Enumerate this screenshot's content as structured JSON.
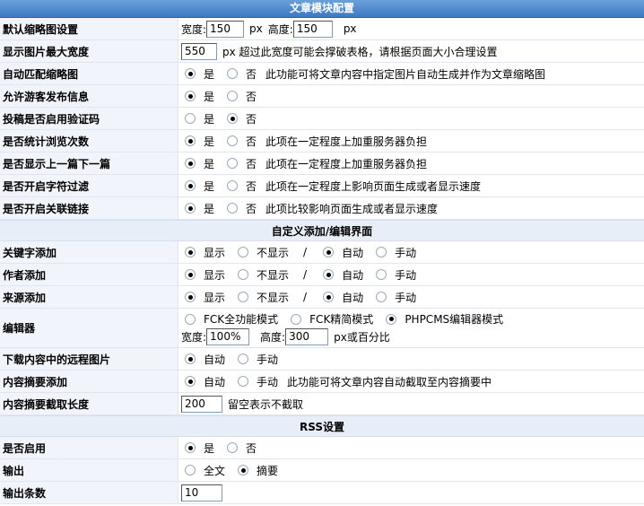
{
  "title": "文章模块配置",
  "sections": {
    "custom": "自定义添加/编辑界面",
    "rss": "RSS设置"
  },
  "rows": {
    "thumb": {
      "label": "默认缩略图设置",
      "width_label": "宽度:",
      "width": "150",
      "px1": "px",
      "height_label": "高度:",
      "height": "150",
      "px2": "px"
    },
    "maxwidth": {
      "label": "显示图片最大宽度",
      "value": "550",
      "note": "px 超过此宽度可能会撑破表格，请根据页面大小合理设置"
    },
    "automatch": {
      "label": "自动匹配缩略图",
      "yes": "是",
      "no": "否",
      "note": "此功能可将文章内容中指定图片自动生成并作为文章缩略图",
      "selected": "yes"
    },
    "guest": {
      "label": "允许游客发布信息",
      "yes": "是",
      "no": "否",
      "selected": "yes"
    },
    "captcha": {
      "label": "投稿是否启用验证码",
      "yes": "是",
      "no": "否",
      "selected": "no"
    },
    "hits": {
      "label": "是否统计浏览次数",
      "yes": "是",
      "no": "否",
      "note": "此项在一定程度上加重服务器负担",
      "selected": "yes"
    },
    "prevnext": {
      "label": "是否显示上一篇下一篇",
      "yes": "是",
      "no": "否",
      "note": "此项在一定程度上加重服务器负担",
      "selected": "yes"
    },
    "filter": {
      "label": "是否开启字符过滤",
      "yes": "是",
      "no": "否",
      "note": "此项在一定程度上影响页面生成或者显示速度",
      "selected": "yes"
    },
    "keylink": {
      "label": "是否开启关联链接",
      "yes": "是",
      "no": "否",
      "note": "此项比较影响页面生成或者显示速度",
      "selected": "yes"
    },
    "keyword": {
      "label": "关键字添加",
      "show": "显示",
      "hide": "不显示",
      "slash": "/",
      "auto": "自动",
      "manual": "手动",
      "display": "show",
      "mode": "auto"
    },
    "author": {
      "label": "作者添加",
      "show": "显示",
      "hide": "不显示",
      "slash": "/",
      "auto": "自动",
      "manual": "手动",
      "display": "show",
      "mode": "auto"
    },
    "source": {
      "label": "来源添加",
      "show": "显示",
      "hide": "不显示",
      "slash": "/",
      "auto": "自动",
      "manual": "手动",
      "display": "show",
      "mode": "auto"
    },
    "editor": {
      "label": "编辑器",
      "opt1": "FCK全功能模式",
      "opt2": "FCK精简模式",
      "opt3": "PHPCMS编辑器模式",
      "selected": "opt3",
      "width_label": "宽度:",
      "width": "100%",
      "height_label": "高度:",
      "height": "300",
      "note": "px或百分比"
    },
    "remote": {
      "label": "下载内容中的远程图片",
      "auto": "自动",
      "manual": "手动",
      "selected": "auto"
    },
    "summary": {
      "label": "内容摘要添加",
      "auto": "自动",
      "manual": "手动",
      "note": "此功能可将文章内容自动截取至内容摘要中",
      "selected": "auto"
    },
    "summarylen": {
      "label": "内容摘要截取长度",
      "value": "200",
      "note": "留空表示不截取"
    },
    "rss_enable": {
      "label": "是否启用",
      "yes": "是",
      "no": "否",
      "selected": "yes"
    },
    "rss_output": {
      "label": "输出",
      "full": "全文",
      "summary": "摘要",
      "selected": "summary"
    },
    "rss_count": {
      "label": "输出条数",
      "value": "10"
    }
  }
}
